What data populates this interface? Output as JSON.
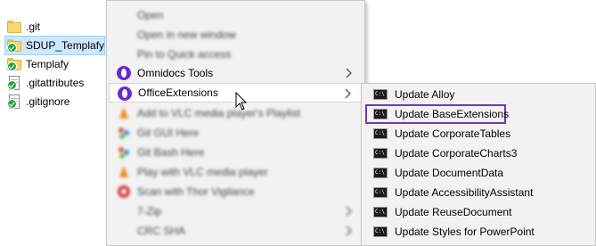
{
  "explorer": {
    "files": [
      {
        "name": ".git",
        "type": "folder",
        "status": null,
        "selected": false
      },
      {
        "name": "SDUP_Templafy",
        "type": "folder",
        "status": "synced",
        "selected": true
      },
      {
        "name": "Templafy",
        "type": "folder",
        "status": "synced",
        "selected": false
      },
      {
        "name": ".gitattributes",
        "type": "file",
        "status": "synced",
        "selected": false
      },
      {
        "name": ".gitignore",
        "type": "file",
        "status": "synced",
        "selected": false
      }
    ]
  },
  "context_menu": {
    "items": [
      {
        "label": "Open",
        "icon": null,
        "blurred": true,
        "bold": true
      },
      {
        "label": "Open in new window",
        "icon": null,
        "blurred": true
      },
      {
        "label": "Pin to Quick access",
        "icon": null,
        "blurred": true
      },
      {
        "label": "Omnidocs Tools",
        "icon": "omnidocs-icon",
        "submenu": true
      },
      {
        "label": "OfficeExtensions",
        "icon": "omnidocs-icon",
        "submenu": true,
        "highlighted": true
      },
      {
        "label": "Add to VLC media player's Playlist",
        "icon": "vlc-icon",
        "blurred": true
      },
      {
        "label": "Git GUI Here",
        "icon": "git-icon",
        "blurred": true
      },
      {
        "label": "Git Bash Here",
        "icon": "git-icon",
        "blurred": true
      },
      {
        "label": "Play with VLC media player",
        "icon": "vlc-icon",
        "blurred": true
      },
      {
        "label": "Scan with Thor Vigilance",
        "icon": "shield-icon",
        "blurred": true
      },
      {
        "label": "7-Zip",
        "icon": null,
        "blurred": true,
        "submenu": true
      },
      {
        "label": "CRC SHA",
        "icon": null,
        "blurred": true,
        "submenu": true
      }
    ]
  },
  "submenu": {
    "items": [
      {
        "label": "Update Alloy",
        "icon": "cmd-icon"
      },
      {
        "label": "Update BaseExtensions",
        "icon": "cmd-icon",
        "focused": true
      },
      {
        "label": "Update CorporateTables",
        "icon": "cmd-icon"
      },
      {
        "label": "Update CorporateCharts3",
        "icon": "cmd-icon"
      },
      {
        "label": "Update DocumentData",
        "icon": "cmd-icon"
      },
      {
        "label": "Update AccessibilityAssistant",
        "icon": "cmd-icon"
      },
      {
        "label": "Update ReuseDocument",
        "icon": "cmd-icon"
      },
      {
        "label": "Update Styles for PowerPoint",
        "icon": "cmd-icon"
      }
    ]
  },
  "colors": {
    "menu_bg": "#f2f2f2",
    "focus_outline": "#6a3bb5",
    "selection_bg": "#cce8ff",
    "omnidocs_purple": "#6a2bd1"
  }
}
